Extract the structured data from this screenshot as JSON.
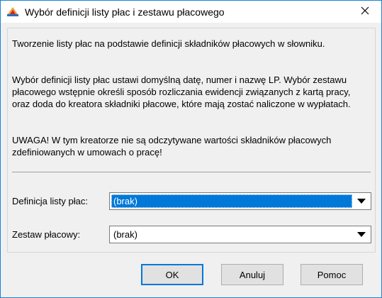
{
  "window": {
    "title": "Wybór definicji listy płac i zestawu płacowego",
    "app_icon": "app-logo-icon",
    "close_icon": "close-icon"
  },
  "info": {
    "line1": "Tworzenie listy płac na podstawie definicji składników płacowych w słowniku.",
    "line2": "Wybór definicji listy płac ustawi domyślną datę, numer i nazwę LP. Wybór zestawu płacowego wstępnie określi sposób rozliczania ewidencji związanych z kartą pracy, oraz doda do kreatora składniki płacowe, które mają zostać naliczone w wypłatach.",
    "line3": "UWAGA! W tym kreatorze nie są odczytywane wartości składników płacowych zdefiniowanych w umowach o pracę!"
  },
  "fields": {
    "definition_label": "Definicja listy płac:",
    "definition_value": "(brak)",
    "set_label": "Zestaw płacowy:",
    "set_value": "(brak)",
    "dropdown_icon": "chevron-down-icon"
  },
  "buttons": {
    "ok": "OK",
    "cancel": "Anuluj",
    "help": "Pomoc"
  },
  "colors": {
    "accent": "#0078d7",
    "window_border": "#1883d7",
    "background": "#f0f0f0"
  }
}
